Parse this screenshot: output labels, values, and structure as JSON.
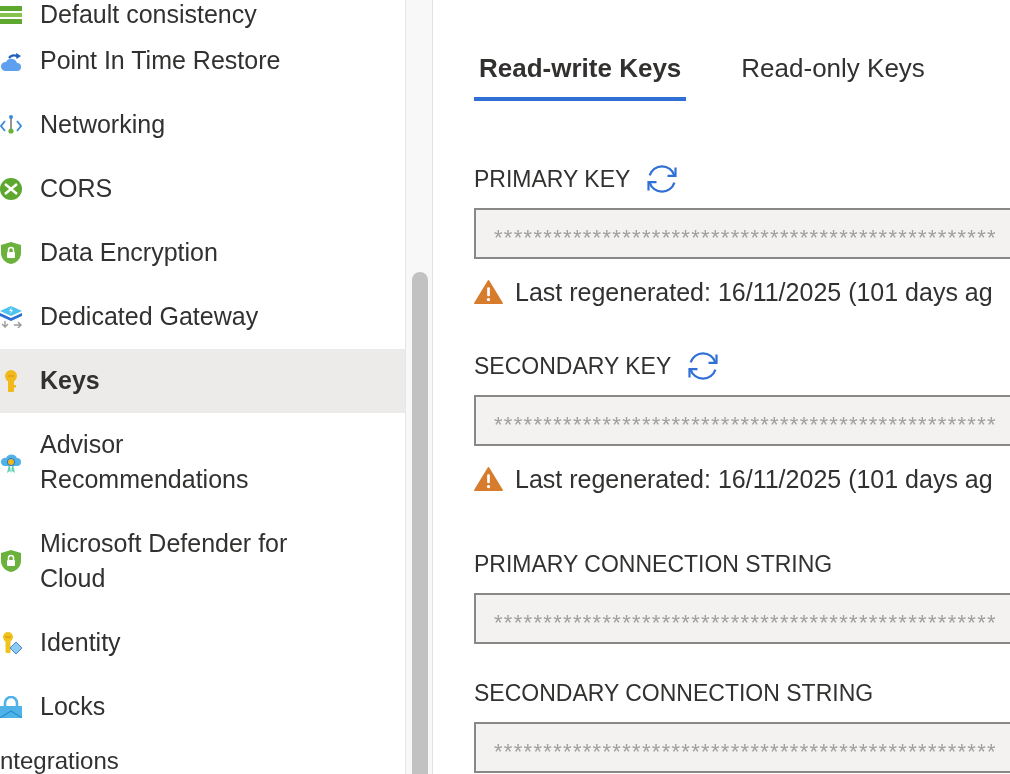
{
  "sidebar": {
    "items": [
      {
        "label": "Default consistency",
        "selected": false
      },
      {
        "label": "Point In Time Restore",
        "selected": false
      },
      {
        "label": "Networking",
        "selected": false
      },
      {
        "label": "CORS",
        "selected": false
      },
      {
        "label": "Data Encryption",
        "selected": false
      },
      {
        "label": "Dedicated Gateway",
        "selected": false
      },
      {
        "label": "Keys",
        "selected": true
      },
      {
        "label": "Advisor Recommendations",
        "selected": false
      },
      {
        "label": "Microsoft Defender for Cloud",
        "selected": false
      },
      {
        "label": "Identity",
        "selected": false
      },
      {
        "label": "Locks",
        "selected": false
      }
    ],
    "section_heading": "ntegrations"
  },
  "tabs": [
    {
      "label": "Read-write Keys",
      "selected": true
    },
    {
      "label": "Read-only Keys",
      "selected": false
    }
  ],
  "fields": [
    {
      "kind": "key",
      "label": "PRIMARY KEY",
      "value": "***************************************************",
      "note": "Last regenerated: 16/11/2025 (101 days ag"
    },
    {
      "kind": "key",
      "label": "SECONDARY KEY",
      "value": "***************************************************",
      "note": "Last regenerated: 16/11/2025 (101 days ag"
    },
    {
      "kind": "connection_string",
      "label": "PRIMARY CONNECTION STRING",
      "value": "***************************************************"
    },
    {
      "kind": "connection_string",
      "label": "SECONDARY CONNECTION STRING",
      "value": "***************************************************"
    }
  ]
}
